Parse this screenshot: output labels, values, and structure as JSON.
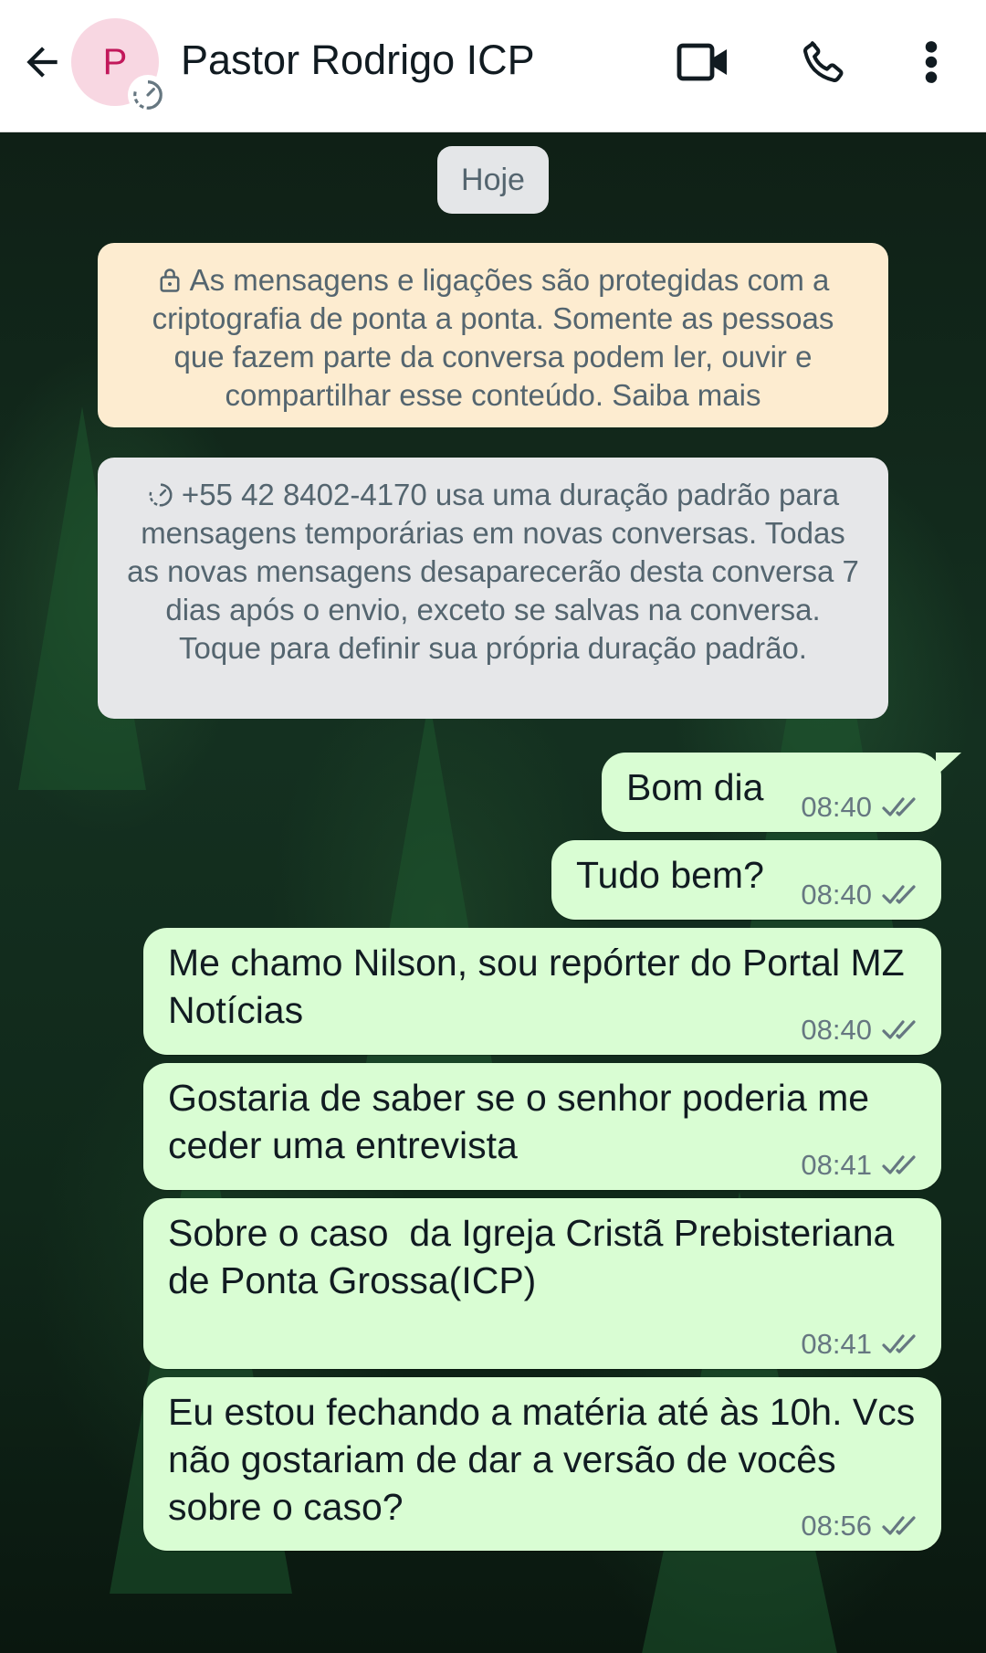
{
  "header": {
    "avatar_letter": "P",
    "contact_name": "Pastor Rodrigo ICP",
    "icons": [
      "back-arrow-icon",
      "disappearing-timer-icon",
      "video-camera-icon",
      "phone-icon",
      "more-vert-icon"
    ]
  },
  "chat": {
    "date_label": "Hoje",
    "encryption_notice": "As mensagens e ligações são protegidas com a criptografia de ponta a ponta. Somente as pessoas que fazem parte da conversa podem ler, ouvir e compartilhar esse conteúdo. Saiba mais",
    "disappearing_notice": "+55 42 8402-4170 usa uma duração padrão para mensagens temporárias em novas conversas. Todas as novas mensagens desaparecerão desta conversa 7 dias após o envio, exceto se salvas na conversa. Toque para definir sua própria duração padrão.",
    "messages": [
      {
        "text": "Bom dia",
        "time": "08:40",
        "status": "delivered"
      },
      {
        "text": "Tudo bem?",
        "time": "08:40",
        "status": "delivered"
      },
      {
        "text": "Me chamo Nilson, sou repórter do Portal MZ Notícias",
        "time": "08:40",
        "status": "delivered"
      },
      {
        "text": "Gostaria de saber se o senhor poderia me ceder uma entrevista",
        "time": "08:41",
        "status": "delivered"
      },
      {
        "text": "Sobre o caso  da Igreja Cristã Prebisteriana de Ponta Grossa(ICP)",
        "time": "08:41",
        "status": "delivered"
      },
      {
        "text": "Eu estou fechando a matéria até às 10h. Vcs não gostariam de dar a versão de vocês sobre o caso?",
        "time": "08:56",
        "status": "delivered"
      }
    ]
  },
  "colors": {
    "outgoing_bubble": "#d9fdd3",
    "encryption_notice_bg": "#fdecd0",
    "system_notice_bg": "#e6e7e9",
    "avatar_bg": "#f8d7e2",
    "avatar_letter": "#c2185b"
  }
}
